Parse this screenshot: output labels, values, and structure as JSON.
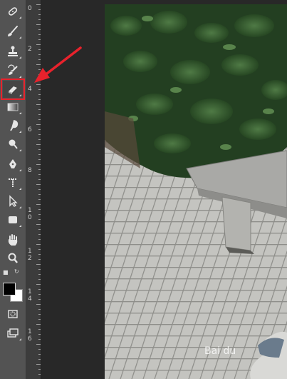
{
  "ruler": {
    "labels": [
      "0",
      "2",
      "4",
      "6",
      "8",
      "1",
      "0",
      "1",
      "2",
      "1",
      "4",
      "1",
      "6"
    ]
  },
  "colors": {
    "foreground": "#000000",
    "background": "#ffffff",
    "highlight": "#e8222c",
    "toolbar": "#535353"
  },
  "tools": [
    {
      "name": "healing-brush-icon"
    },
    {
      "name": "brush-icon"
    },
    {
      "name": "clone-stamp-icon"
    },
    {
      "name": "history-brush-icon"
    },
    {
      "name": "eraser-icon"
    },
    {
      "name": "gradient-icon"
    },
    {
      "name": "blur-icon"
    },
    {
      "name": "dodge-icon"
    },
    {
      "name": "pen-icon"
    },
    {
      "name": "type-icon"
    },
    {
      "name": "path-selection-icon"
    },
    {
      "name": "rectangle-icon"
    },
    {
      "name": "hand-icon"
    },
    {
      "name": "zoom-icon"
    }
  ]
}
